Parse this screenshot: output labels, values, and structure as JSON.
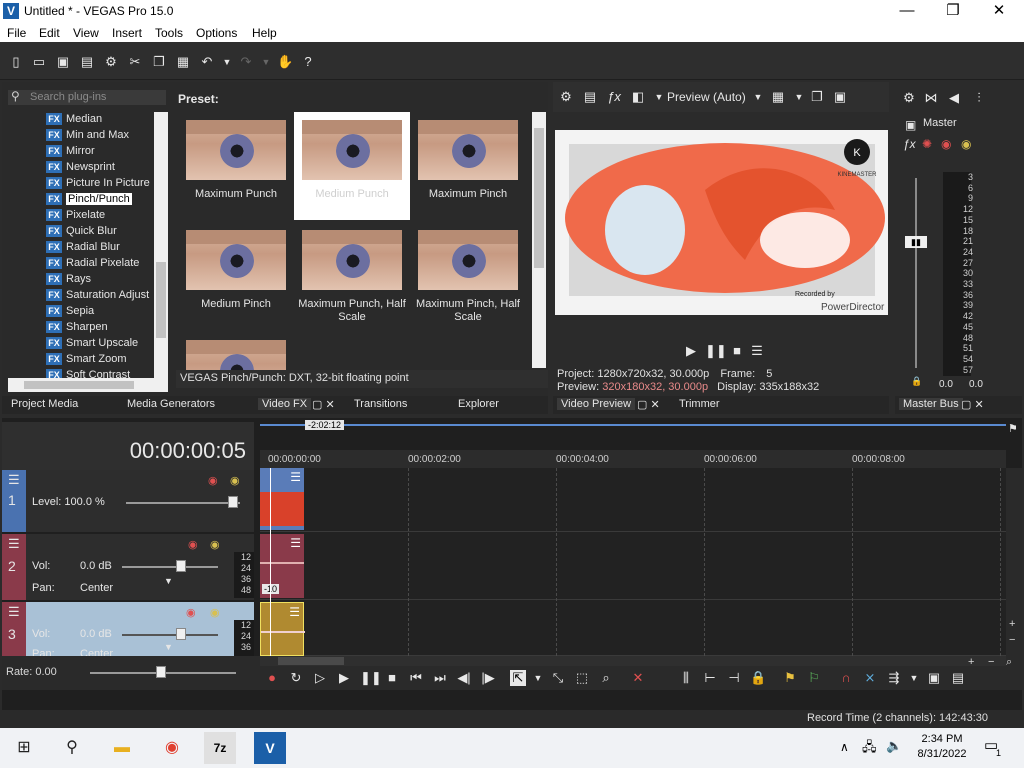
{
  "window": {
    "title": "Untitled * - VEGAS Pro 15.0",
    "app_icon": "V",
    "minimize": "—",
    "maximize": "❐",
    "close": "✕"
  },
  "menu": [
    "File",
    "Edit",
    "View",
    "Insert",
    "Tools",
    "Options",
    "Help"
  ],
  "toolbar": {
    "icons": [
      "new-icon",
      "open-icon",
      "save-icon",
      "save-as-icon",
      "properties-icon",
      "cut-icon",
      "copy-icon",
      "paste-icon",
      "undo-icon",
      "undo-dropdown-icon",
      "redo-icon",
      "redo-dropdown-icon",
      "hand-icon",
      "help-icon"
    ]
  },
  "plugins": {
    "search_placeholder": "Search plug-ins",
    "items": [
      "Median",
      "Min and Max",
      "Mirror",
      "Newsprint",
      "Picture In Picture",
      "Pinch/Punch",
      "Pixelate",
      "Quick Blur",
      "Radial Blur",
      "Radial Pixelate",
      "Rays",
      "Saturation Adjust",
      "Sepia",
      "Sharpen",
      "Smart Upscale",
      "Smart Zoom",
      "Soft Contrast"
    ],
    "selected": "Pinch/Punch",
    "preset_label": "Preset:",
    "presets": [
      "Maximum Punch",
      "Medium Punch",
      "Maximum Pinch",
      "Medium Pinch",
      "Maximum Punch, Half Scale",
      "Maximum Pinch, Half Scale"
    ],
    "status": "VEGAS Pinch/Punch: DXT, 32-bit floating point"
  },
  "tabs_left": [
    "Project Media",
    "Media Generators",
    "Video FX",
    "Transitions",
    "Explorer"
  ],
  "tabs_preview": [
    "Video Preview",
    "Trimmer"
  ],
  "tabs_master": [
    "Master Bus"
  ],
  "preview": {
    "mode": "Preview (Auto)",
    "watermark_top": "KINEMASTER",
    "watermark_badge": "K",
    "watermark_recorded": "Recorded by",
    "watermark_bottom": "PowerDirector",
    "project_label": "Project:",
    "project_value": "1280x720x32, 30.000p",
    "frame_label": "Frame:",
    "frame_value": "5",
    "preview_label": "Preview:",
    "preview_value": "320x180x32, 30.000p",
    "display_label": "Display:",
    "display_value": "335x188x32"
  },
  "master": {
    "label": "Master",
    "scale": [
      "3",
      "6",
      "9",
      "12",
      "15",
      "18",
      "21",
      "24",
      "27",
      "30",
      "33",
      "36",
      "39",
      "42",
      "45",
      "48",
      "51",
      "54",
      "57"
    ],
    "left_value": "0.0",
    "right_value": "0.0"
  },
  "timeline": {
    "timecode": "00:00:00:05",
    "marker_time": "-2:02:12",
    "ruler": [
      "00:00:00:00",
      "00:00:02:00",
      "00:00:04:00",
      "00:00:06:00",
      "00:00:08:00"
    ],
    "rate": "Rate: 0.00",
    "tracks": [
      {
        "number": "1",
        "level": "Level: 100.0 %"
      },
      {
        "number": "2",
        "vol_label": "Vol:",
        "vol_value": "0.0 dB",
        "pan_label": "Pan:",
        "pan_value": "Center",
        "meter": [
          "12",
          "24",
          "36",
          "48"
        ],
        "clip_badge": "-10"
      },
      {
        "number": "3",
        "vol_label": "Vol:",
        "vol_value": "0.0 dB",
        "pan_label": "Pan:",
        "pan_value": "Center",
        "meter": [
          "12",
          "24",
          "36"
        ]
      }
    ]
  },
  "status": {
    "record_time": "Record Time (2 channels): 142:43:30"
  },
  "taskbar": {
    "time": "2:34 PM",
    "date": "8/31/2022",
    "notif_count": "1",
    "apps": [
      "start-icon",
      "search-icon",
      "file-explorer-icon",
      "chrome-icon",
      "7zip-icon",
      "vegas-icon"
    ]
  }
}
